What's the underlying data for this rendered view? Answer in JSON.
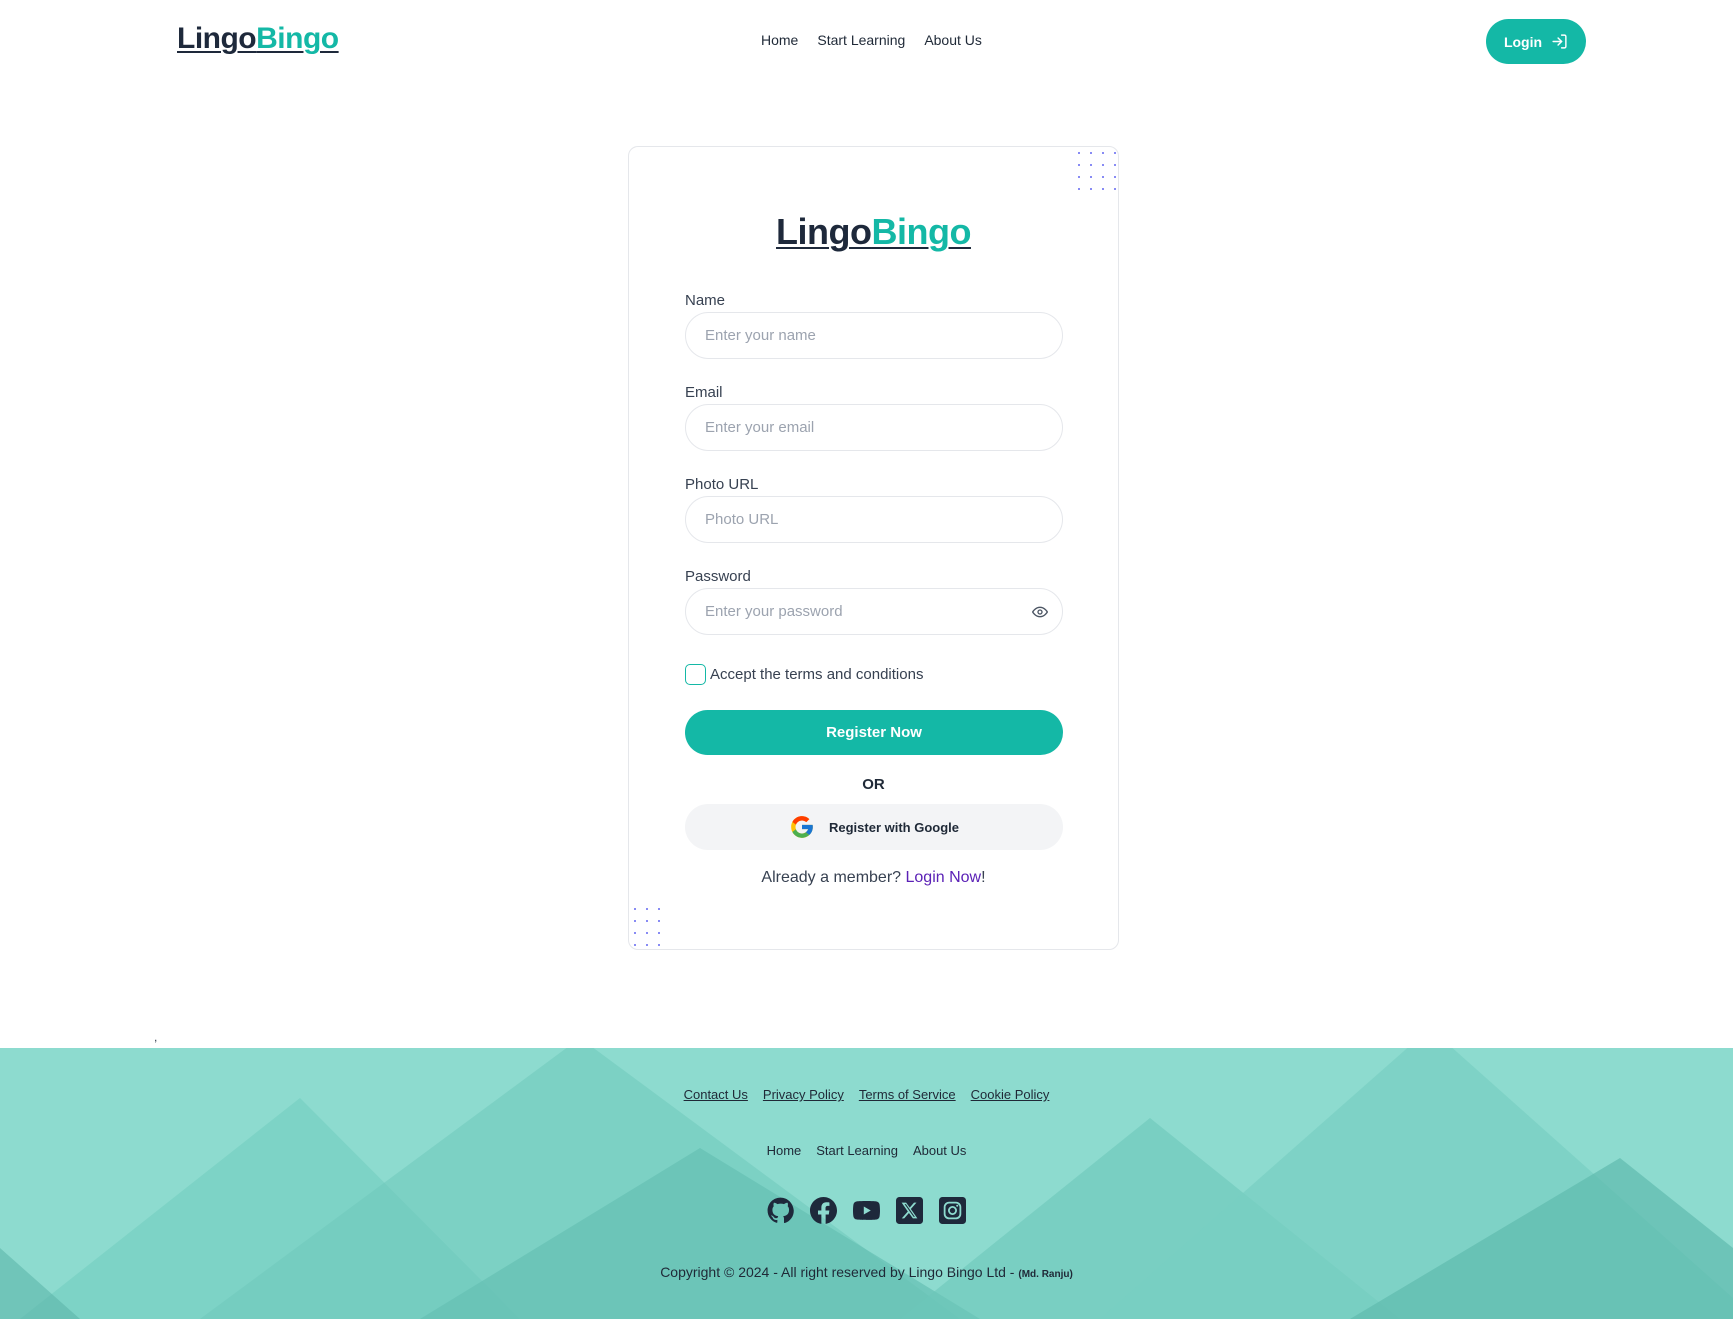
{
  "header": {
    "logo_part1": "Lingo",
    "logo_part2": "Bingo",
    "nav": [
      "Home",
      "Start Learning",
      "About Us"
    ],
    "login_label": "Login"
  },
  "card": {
    "logo_part1": "Lingo",
    "logo_part2": "Bingo",
    "fields": {
      "name": {
        "label": "Name",
        "placeholder": "Enter your name"
      },
      "email": {
        "label": "Email",
        "placeholder": "Enter your email"
      },
      "photo": {
        "label": "Photo URL",
        "placeholder": "Photo URL"
      },
      "password": {
        "label": "Password",
        "placeholder": "Enter your password"
      }
    },
    "terms_label": "Accept the terms and conditions",
    "register_label": "Register Now",
    "or_label": "OR",
    "google_label": "Register with Google",
    "member_text": "Already a member?",
    "login_link": "Login Now",
    "exclamation": "!"
  },
  "stray_mark": ",",
  "footer": {
    "links": [
      "Contact Us",
      "Privacy Policy",
      "Terms of Service",
      "Cookie Policy"
    ],
    "nav": [
      "Home",
      "Start Learning",
      "About Us"
    ],
    "social_icons": [
      "github-icon",
      "facebook-icon",
      "youtube-icon",
      "x-icon",
      "instagram-icon"
    ],
    "copyright": "Copyright © 2024 - All right reserved by Lingo Bingo Ltd - ",
    "author": "(Md. Ranju)"
  },
  "colors": {
    "brand": "#14b8a6",
    "dark": "#1e293b",
    "footer_bg": "#8ddbcf",
    "link": "#5b21b6",
    "dots": "#6366f1"
  }
}
